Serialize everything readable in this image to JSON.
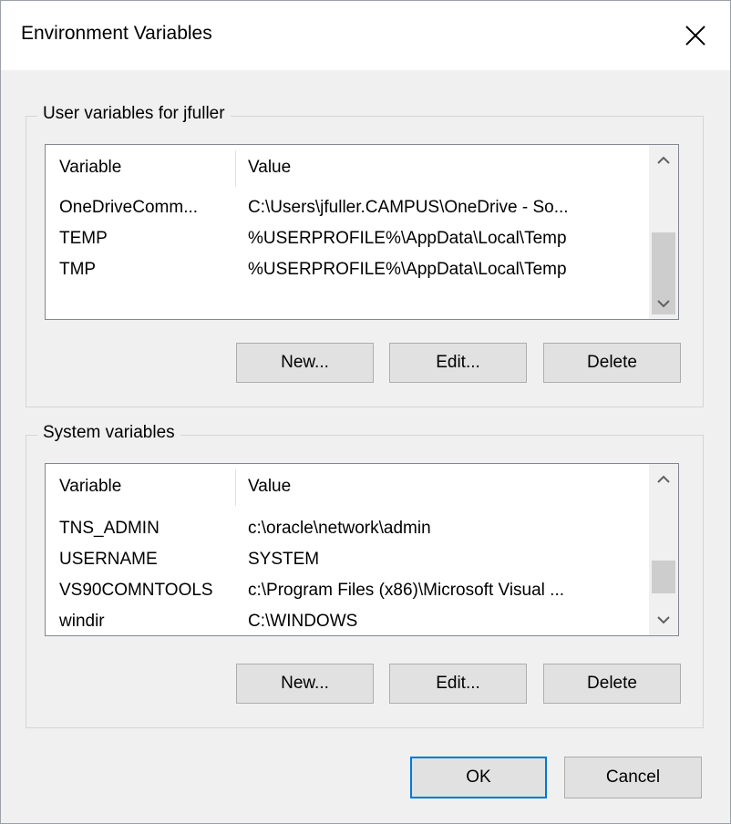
{
  "window": {
    "title": "Environment Variables"
  },
  "user_vars": {
    "label": "User variables for jfuller",
    "columns": [
      "Variable",
      "Value"
    ],
    "rows": [
      {
        "variable": "OneDriveComm...",
        "value": "C:\\Users\\jfuller.CAMPUS\\OneDrive - So..."
      },
      {
        "variable": "TEMP",
        "value": "%USERPROFILE%\\AppData\\Local\\Temp"
      },
      {
        "variable": "TMP",
        "value": "%USERPROFILE%\\AppData\\Local\\Temp"
      }
    ],
    "buttons": {
      "new": "New...",
      "edit": "Edit...",
      "delete": "Delete"
    }
  },
  "system_vars": {
    "label": "System variables",
    "columns": [
      "Variable",
      "Value"
    ],
    "rows": [
      {
        "variable": "TNS_ADMIN",
        "value": "c:\\oracle\\network\\admin"
      },
      {
        "variable": "USERNAME",
        "value": "SYSTEM"
      },
      {
        "variable": "VS90COMNTOOLS",
        "value": "c:\\Program Files (x86)\\Microsoft Visual ..."
      },
      {
        "variable": "windir",
        "value": "C:\\WINDOWS"
      }
    ],
    "buttons": {
      "new": "New...",
      "edit": "Edit...",
      "delete": "Delete"
    }
  },
  "footer": {
    "ok": "OK",
    "cancel": "Cancel"
  },
  "icons": {
    "close": "close-icon",
    "scroll_up": "chevron-up-icon",
    "scroll_down": "chevron-down-icon"
  },
  "colors": {
    "default_button_border": "#0078d7",
    "window_bg": "#f0f0f0",
    "list_bg": "#ffffff"
  }
}
